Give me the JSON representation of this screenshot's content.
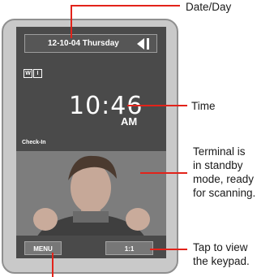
{
  "screen": {
    "date_day": "12-10-04  Thursday",
    "mode_badges": [
      "W",
      "I"
    ],
    "time": "10:46",
    "ampm": "AM",
    "status_label": "Check-In",
    "buttons": {
      "menu": "MENU",
      "one_to_one": "1:1"
    }
  },
  "callouts": {
    "date_day": "Date/Day",
    "time": "Time",
    "standby": [
      "Terminal is",
      "in standby",
      "mode, ready",
      "for scanning."
    ],
    "keypad": [
      "Tap to view",
      "the keypad."
    ]
  },
  "colors": {
    "callout_line": "#e2231a",
    "screen_bg": "#4a4a4a"
  }
}
